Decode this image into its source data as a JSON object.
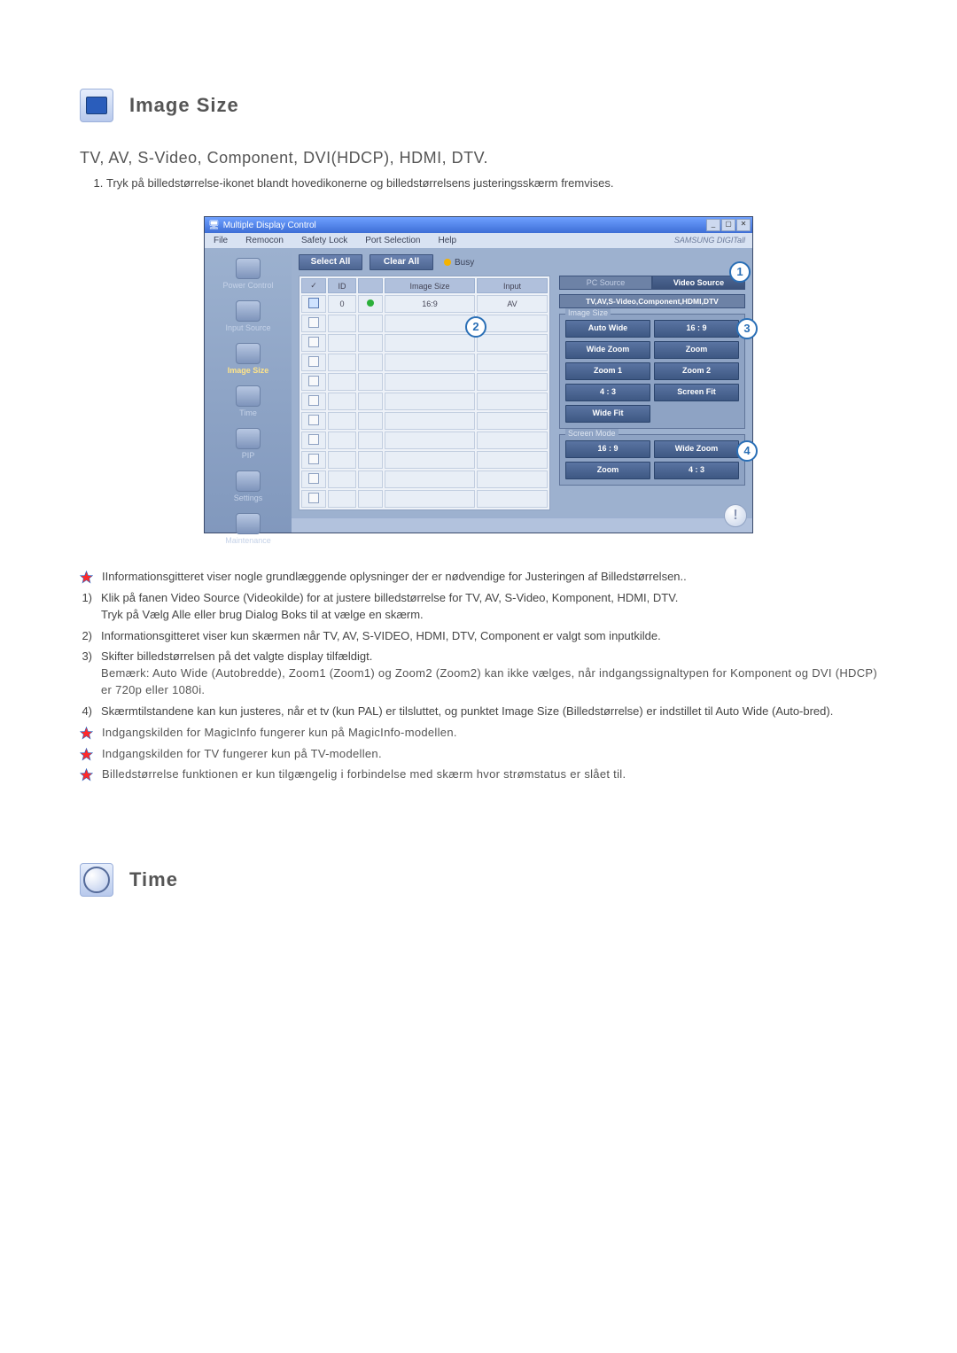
{
  "sections": {
    "imageSize": {
      "title": "Image Size"
    },
    "time": {
      "title": "Time"
    }
  },
  "subheading": "TV, AV, S-Video, Component, DVI(HDCP), HDMI, DTV.",
  "intro_list": {
    "item1": "Tryk på billedstørrelse-ikonet blandt hovedikonerne og billedstørrelsens justeringsskærm fremvises."
  },
  "app": {
    "title": "Multiple Display Control",
    "brand": "SAMSUNG DIGITall",
    "menus": [
      "File",
      "Remocon",
      "Safety Lock",
      "Port Selection",
      "Help"
    ],
    "topButtons": {
      "selectAll": "Select All",
      "clearAll": "Clear All",
      "busy": "Busy"
    },
    "sidebar": [
      {
        "label": "Power Control"
      },
      {
        "label": "Input Source"
      },
      {
        "label": "Image Size",
        "selected": true
      },
      {
        "label": "Time"
      },
      {
        "label": "PIP"
      },
      {
        "label": "Settings"
      },
      {
        "label": "Maintenance"
      }
    ],
    "grid": {
      "headers": {
        "chk": "✓",
        "id": "ID",
        "status": " ",
        "imageSize": "Image Size",
        "input": "Input"
      },
      "rows": [
        {
          "checked": true,
          "id": "0",
          "status": "on",
          "imageSize": "16:9",
          "input": "AV"
        }
      ],
      "emptyRows": 10
    },
    "panel": {
      "tabs": {
        "pc": "PC Source",
        "video": "Video Source",
        "active": "video"
      },
      "videoLabel": "TV,AV,S-Video,Component,HDMI,DTV",
      "legend1": "Image Size",
      "imageSizeButtons": [
        "Auto Wide",
        "16 : 9",
        "Wide Zoom",
        "Zoom",
        "Zoom 1",
        "Zoom 2",
        "4 : 3",
        "Screen Fit",
        "Wide Fit"
      ],
      "legend2": "Screen Mode",
      "screenModeButtons": [
        "16 : 9",
        "Wide Zoom",
        "Zoom",
        "4 : 3"
      ]
    },
    "callouts": {
      "c1": "1",
      "c2": "2",
      "c3": "3",
      "c4": "4"
    }
  },
  "notes": {
    "s1": "IInformationsgitteret viser nogle grundlæggende oplysninger der er nødvendige for Justeringen af Billedstørrelsen..",
    "n1a": "Klik på fanen Video Source (Videokilde) for at justere billedstørrelse for TV, AV, S-Video, Komponent, HDMI, DTV.",
    "n1b": "Tryk på Vælg Alle eller brug Dialog Boks til at vælge en skærm.",
    "n2": "Informationsgitteret viser kun skærmen når TV, AV, S-VIDEO, HDMI, DTV, Component er valgt som inputkilde.",
    "n3a": "Skifter billedstørrelsen på det valgte display tilfældigt.",
    "n3b": "Bemærk: Auto Wide (Autobredde), Zoom1 (Zoom1) og Zoom2 (Zoom2) kan ikke vælges, når indgangssignaltypen for Komponent og DVI (HDCP) er 720p eller 1080i.",
    "n4": "Skærmtilstandene kan kun justeres, når et tv (kun PAL) er tilsluttet, og punktet Image Size (Billedstørrelse) er indstillet til Auto Wide (Auto-bred).",
    "s2": "Indgangskilden for MagicInfo fungerer kun på MagicInfo-modellen.",
    "s3": "Indgangskilden for TV fungerer kun på TV-modellen.",
    "s4": "Billedstørrelse funktionen er kun tilgængelig i forbindelse med skærm hvor strømstatus er slået til."
  }
}
